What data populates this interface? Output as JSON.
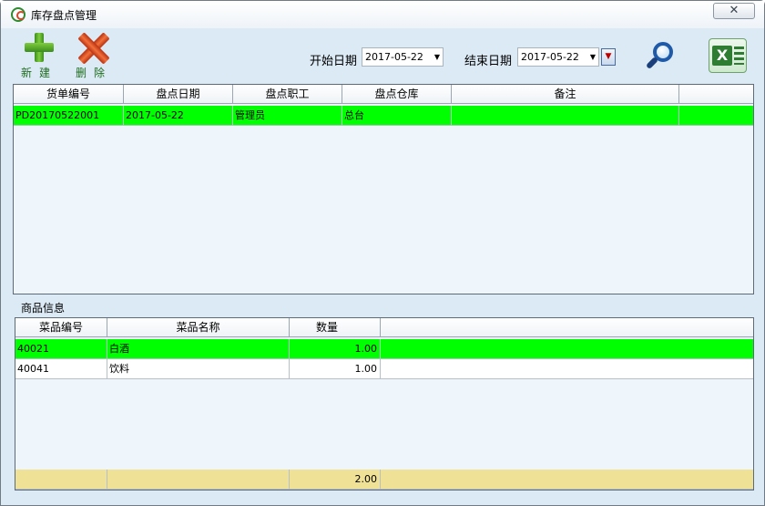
{
  "window": {
    "title": "库存盘点管理",
    "close_symbol": "✕"
  },
  "toolbar": {
    "new_label": "新建",
    "delete_label": "删除",
    "start_date_label": "开始日期",
    "start_date_value": "2017-05-22",
    "end_date_label": "结束日期",
    "end_date_value": "2017-05-22",
    "dropdown_symbol": "▼",
    "icons": [
      "plus-icon",
      "delete-x-icon",
      "search-icon",
      "excel-icon"
    ]
  },
  "inventory_grid": {
    "headers": [
      "货单编号",
      "盘点日期",
      "盘点职工",
      "盘点仓库",
      "备注"
    ],
    "rows": [
      {
        "order_no": "PD20170522001",
        "date": "2017-05-22",
        "staff": "管理员",
        "warehouse": "总台",
        "note": ""
      }
    ]
  },
  "goods_section": {
    "label": "商品信息"
  },
  "goods_grid": {
    "headers": [
      "菜品编号",
      "菜品名称",
      "数量"
    ],
    "rows": [
      {
        "code": "40021",
        "name": "白酒",
        "qty": "1.00"
      },
      {
        "code": "40041",
        "name": "饮料",
        "qty": "1.00"
      }
    ],
    "total_qty": "2.00"
  },
  "colors": {
    "selected_row": "#00ff00",
    "total_row": "#efe196",
    "background": "#dceaf5"
  }
}
